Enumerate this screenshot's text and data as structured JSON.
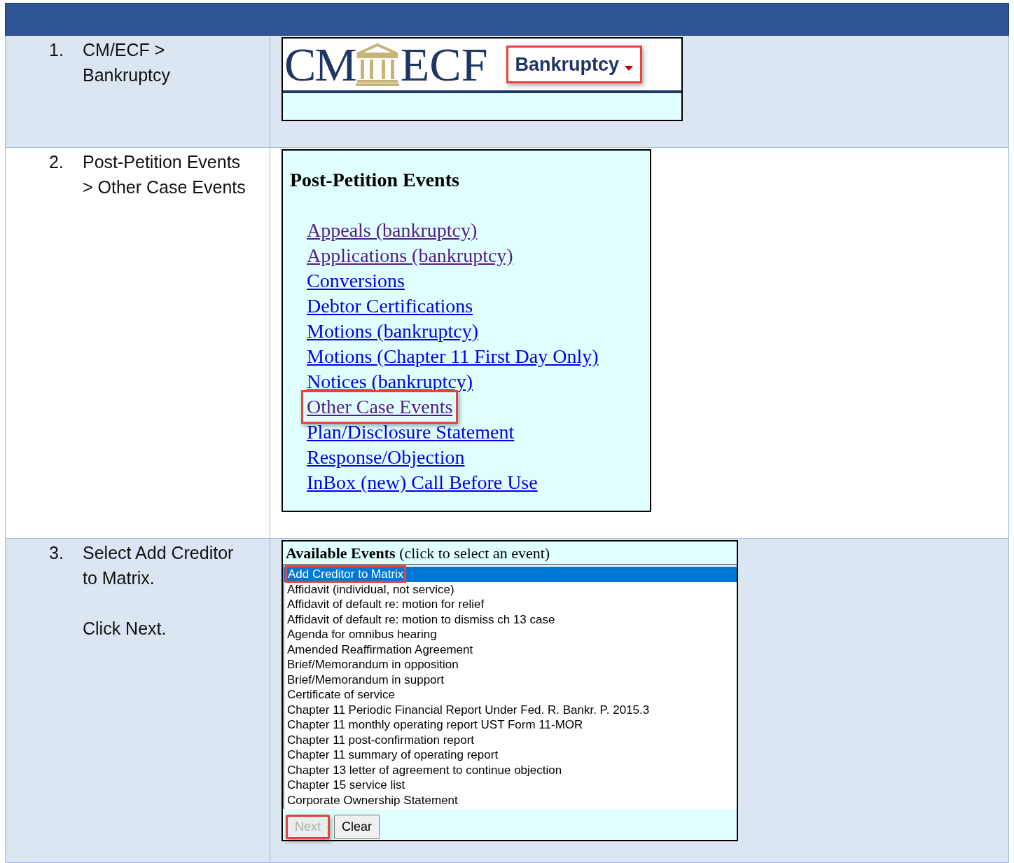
{
  "steps": [
    {
      "number": "1.",
      "instruction": [
        [
          "CM/ECF >",
          "Bankruptcy"
        ]
      ],
      "kind": "banner",
      "banner": {
        "logo_left": "CM",
        "logo_right": "ECF",
        "menu": {
          "label": "Bankruptcy",
          "highlighted": true
        }
      }
    },
    {
      "number": "2.",
      "instruction": [
        [
          "Post-Petition Events",
          "> Other Case Events"
        ]
      ],
      "kind": "menu",
      "menu": {
        "title": "Post-Petition Events",
        "links": [
          {
            "label": "Appeals (bankruptcy)",
            "visited": true,
            "highlighted": false
          },
          {
            "label": "Applications (bankruptcy)",
            "visited": true,
            "highlighted": false
          },
          {
            "label": "Conversions",
            "visited": false,
            "highlighted": false
          },
          {
            "label": "Debtor Certifications",
            "visited": false,
            "highlighted": false
          },
          {
            "label": "Motions (bankruptcy)",
            "visited": false,
            "highlighted": false
          },
          {
            "label": "Motions (Chapter 11 First Day Only)",
            "visited": false,
            "highlighted": false
          },
          {
            "label": "Notices (bankruptcy)",
            "visited": false,
            "highlighted": false
          },
          {
            "label": "Other Case Events",
            "visited": true,
            "highlighted": true
          },
          {
            "label": "Plan/Disclosure Statement",
            "visited": false,
            "highlighted": false
          },
          {
            "label": "Response/Objection",
            "visited": false,
            "highlighted": false
          },
          {
            "label": "InBox (new) Call Before Use",
            "visited": false,
            "highlighted": false
          }
        ]
      }
    },
    {
      "number": "3.",
      "instruction": [
        [
          "Select Add Creditor",
          "to Matrix."
        ],
        [
          "Click Next."
        ]
      ],
      "kind": "event_list",
      "events": {
        "heading": "**Available Events** (click to select an event)",
        "items": [
          {
            "label": "Add Creditor to Matrix",
            "selected": true,
            "highlighted": true
          },
          {
            "label": "Affidavit (individual, not service)",
            "selected": false,
            "highlighted": false
          },
          {
            "label": "Affidavit of default re: motion for relief",
            "selected": false,
            "highlighted": false
          },
          {
            "label": "Affidavit of default re: motion to dismiss ch 13 case",
            "selected": false,
            "highlighted": false
          },
          {
            "label": "Agenda for omnibus hearing",
            "selected": false,
            "highlighted": false
          },
          {
            "label": "Amended Reaffirmation Agreement",
            "selected": false,
            "highlighted": false
          },
          {
            "label": "Brief/Memorandum in opposition",
            "selected": false,
            "highlighted": false
          },
          {
            "label": "Brief/Memorandum in support",
            "selected": false,
            "highlighted": false
          },
          {
            "label": "Certificate of service",
            "selected": false,
            "highlighted": false
          },
          {
            "label": "Chapter 11 Periodic Financial Report Under Fed. R. Bankr. P. 2015.3",
            "selected": false,
            "highlighted": false
          },
          {
            "label": "Chapter 11 monthly operating report UST Form 11-MOR",
            "selected": false,
            "highlighted": false
          },
          {
            "label": "Chapter 11 post-confirmation report",
            "selected": false,
            "highlighted": false
          },
          {
            "label": "Chapter 11 summary of operating report",
            "selected": false,
            "highlighted": false
          },
          {
            "label": "Chapter 13 letter of agreement to continue objection",
            "selected": false,
            "highlighted": false
          },
          {
            "label": "Chapter 15 service list",
            "selected": false,
            "highlighted": false
          },
          {
            "label": "Corporate Ownership Statement",
            "selected": false,
            "highlighted": false
          }
        ],
        "buttons": [
          {
            "label": "Next",
            "disabled": true,
            "highlighted": true
          },
          {
            "label": "Clear",
            "disabled": false,
            "highlighted": false
          }
        ]
      }
    }
  ]
}
